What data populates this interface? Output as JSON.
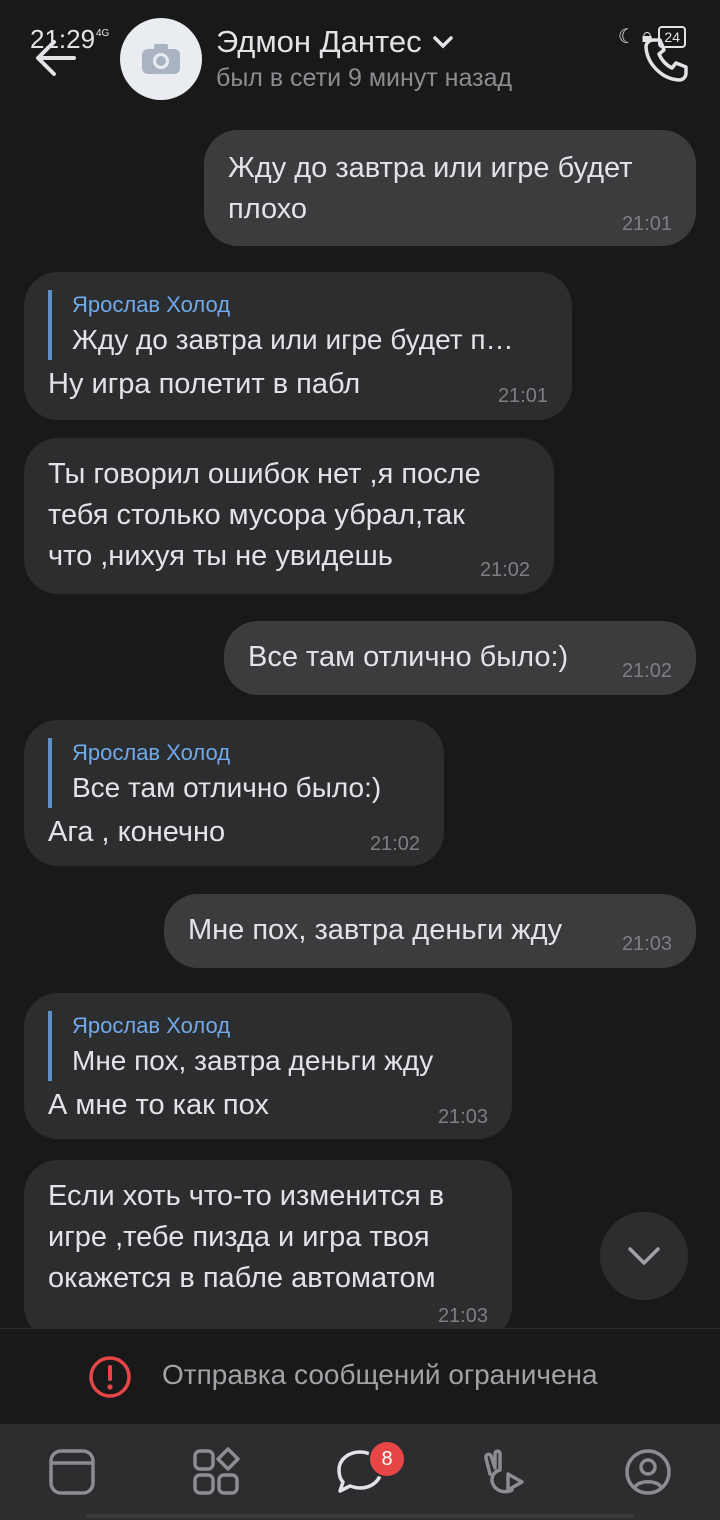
{
  "status_bar": {
    "time": "21:29",
    "network": "4G",
    "battery": "24"
  },
  "header": {
    "contact_name": "Эдмон Дантес",
    "presence": "был в сети 9 минут назад"
  },
  "messages": [
    {
      "direction": "out",
      "text": "Жду до завтра или игре будет\nплохо",
      "time": "21:01"
    },
    {
      "direction": "in",
      "reply_author": "Ярослав Холод",
      "reply_text": "Жду до завтра или игре будет п…",
      "text": "Ну игра полетит в пабл",
      "time": "21:01"
    },
    {
      "direction": "in",
      "text": "Ты говорил ошибок нет ,я после\nтебя столько мусора убрал,так\nчто ,нихуя ты не увидешь",
      "time": "21:02"
    },
    {
      "direction": "out",
      "text": "Все там отлично было:)",
      "time": "21:02"
    },
    {
      "direction": "in",
      "reply_author": "Ярослав Холод",
      "reply_text": "Все там отлично было:)",
      "text": "Ага , конечно",
      "time": "21:02"
    },
    {
      "direction": "out",
      "text": "Мне пох, завтра деньги жду",
      "time": "21:03"
    },
    {
      "direction": "in",
      "reply_author": "Ярослав Холод",
      "reply_text": "Мне пох, завтра деньги жду",
      "text": "А мне то как пох",
      "time": "21:03"
    },
    {
      "direction": "in",
      "text": "Если хоть что-то изменится в\nигре ,тебе пизда и игра твоя\nокажется в пабле автоматом",
      "time": "21:03"
    }
  ],
  "restriction": {
    "text": "Отправка сообщений ограничена",
    "color": "#e64646"
  },
  "bottom_nav": {
    "items": [
      "news-icon",
      "services-icon",
      "messages-icon",
      "clips-icon",
      "profile-icon"
    ],
    "active": "messages-icon",
    "messages_badge": "8"
  },
  "colors": {
    "background": "#19191a",
    "incoming_bubble": "#2c2d2e",
    "outgoing_bubble": "#3b3c3e",
    "accent": "#71aaeb"
  }
}
